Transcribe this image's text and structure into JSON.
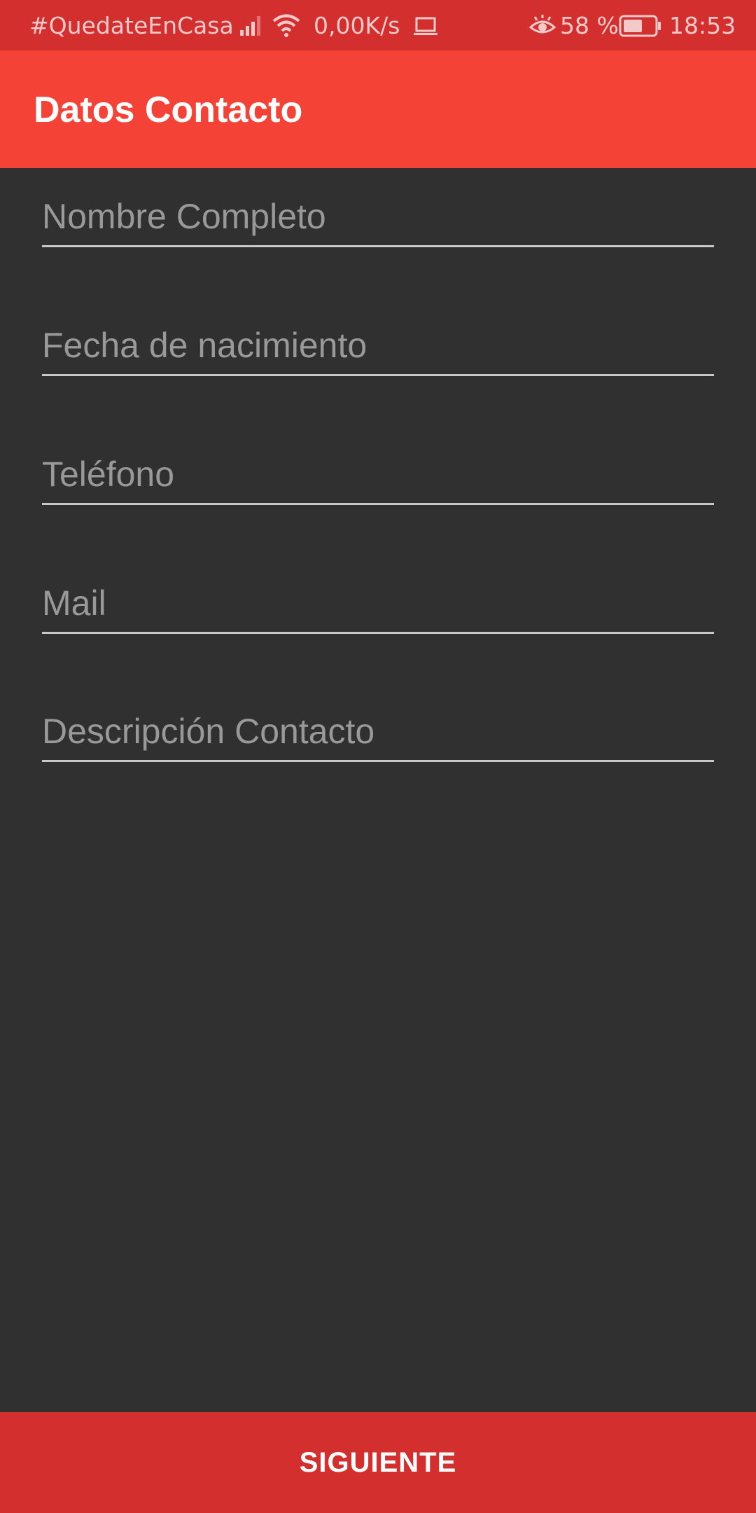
{
  "status_bar": {
    "carrier": "#QuedateEnCasa",
    "net_speed": "0,00K/s",
    "battery_percent": "58 %",
    "time": "18:53",
    "icons": [
      "signal-icon",
      "wifi-icon",
      "laptop-icon",
      "eye-icon",
      "battery-icon"
    ]
  },
  "app_bar": {
    "title": "Datos Contacto"
  },
  "form": {
    "fields": [
      {
        "placeholder": "Nombre Completo",
        "value": ""
      },
      {
        "placeholder": "Fecha de nacimiento",
        "value": ""
      },
      {
        "placeholder": "Teléfono",
        "value": ""
      },
      {
        "placeholder": "Mail",
        "value": ""
      },
      {
        "placeholder": "Descripción Contacto",
        "value": ""
      }
    ]
  },
  "footer": {
    "next_label": "SIGUIENTE"
  },
  "colors": {
    "status_bar": "#d32f2f",
    "app_bar": "#f44336",
    "background": "#303030",
    "button": "#d32f2f",
    "placeholder": "#999999",
    "underline": "#c8c8c8"
  }
}
